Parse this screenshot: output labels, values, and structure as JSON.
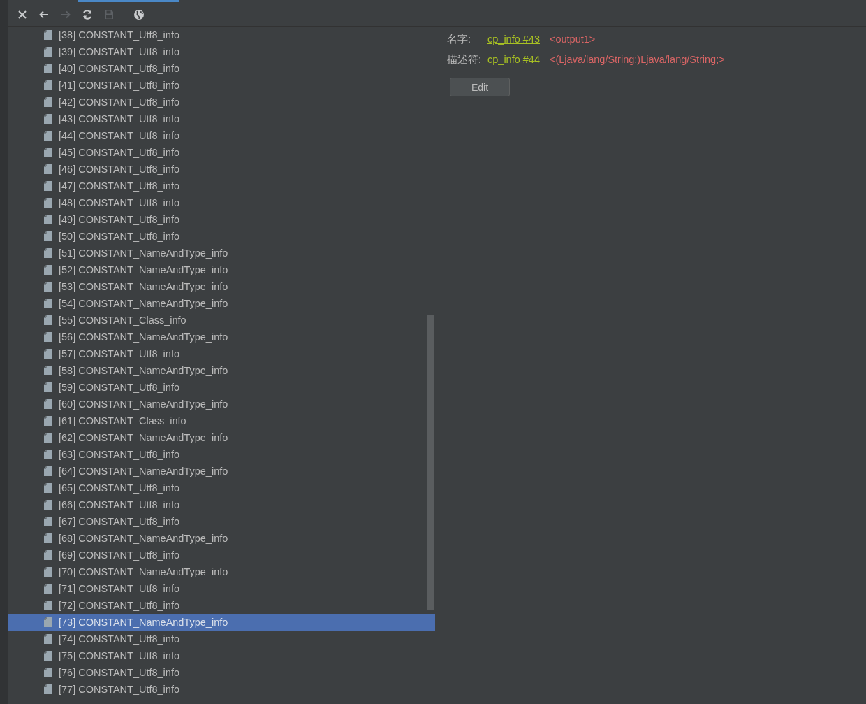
{
  "toolbar": [
    {
      "kind": "close",
      "disabled": false
    },
    {
      "kind": "back",
      "disabled": false
    },
    {
      "kind": "forward",
      "disabled": true
    },
    {
      "kind": "refresh",
      "disabled": false
    },
    {
      "kind": "save",
      "disabled": true
    },
    {
      "kind": "globe",
      "disabled": false
    }
  ],
  "tree": {
    "items": [
      {
        "label": "[38] CONSTANT_Utf8_info",
        "selected": false
      },
      {
        "label": "[39] CONSTANT_Utf8_info",
        "selected": false
      },
      {
        "label": "[40] CONSTANT_Utf8_info",
        "selected": false
      },
      {
        "label": "[41] CONSTANT_Utf8_info",
        "selected": false
      },
      {
        "label": "[42] CONSTANT_Utf8_info",
        "selected": false
      },
      {
        "label": "[43] CONSTANT_Utf8_info",
        "selected": false
      },
      {
        "label": "[44] CONSTANT_Utf8_info",
        "selected": false
      },
      {
        "label": "[45] CONSTANT_Utf8_info",
        "selected": false
      },
      {
        "label": "[46] CONSTANT_Utf8_info",
        "selected": false
      },
      {
        "label": "[47] CONSTANT_Utf8_info",
        "selected": false
      },
      {
        "label": "[48] CONSTANT_Utf8_info",
        "selected": false
      },
      {
        "label": "[49] CONSTANT_Utf8_info",
        "selected": false
      },
      {
        "label": "[50] CONSTANT_Utf8_info",
        "selected": false
      },
      {
        "label": "[51] CONSTANT_NameAndType_info",
        "selected": false
      },
      {
        "label": "[52] CONSTANT_NameAndType_info",
        "selected": false
      },
      {
        "label": "[53] CONSTANT_NameAndType_info",
        "selected": false
      },
      {
        "label": "[54] CONSTANT_NameAndType_info",
        "selected": false
      },
      {
        "label": "[55] CONSTANT_Class_info",
        "selected": false
      },
      {
        "label": "[56] CONSTANT_NameAndType_info",
        "selected": false
      },
      {
        "label": "[57] CONSTANT_Utf8_info",
        "selected": false
      },
      {
        "label": "[58] CONSTANT_NameAndType_info",
        "selected": false
      },
      {
        "label": "[59] CONSTANT_Utf8_info",
        "selected": false
      },
      {
        "label": "[60] CONSTANT_NameAndType_info",
        "selected": false
      },
      {
        "label": "[61] CONSTANT_Class_info",
        "selected": false
      },
      {
        "label": "[62] CONSTANT_NameAndType_info",
        "selected": false
      },
      {
        "label": "[63] CONSTANT_Utf8_info",
        "selected": false
      },
      {
        "label": "[64] CONSTANT_NameAndType_info",
        "selected": false
      },
      {
        "label": "[65] CONSTANT_Utf8_info",
        "selected": false
      },
      {
        "label": "[66] CONSTANT_Utf8_info",
        "selected": false
      },
      {
        "label": "[67] CONSTANT_Utf8_info",
        "selected": false
      },
      {
        "label": "[68] CONSTANT_NameAndType_info",
        "selected": false
      },
      {
        "label": "[69] CONSTANT_Utf8_info",
        "selected": false
      },
      {
        "label": "[70] CONSTANT_NameAndType_info",
        "selected": false
      },
      {
        "label": "[71] CONSTANT_Utf8_info",
        "selected": false
      },
      {
        "label": "[72] CONSTANT_Utf8_info",
        "selected": false
      },
      {
        "label": "[73] CONSTANT_NameAndType_info",
        "selected": true
      },
      {
        "label": "[74] CONSTANT_Utf8_info",
        "selected": false
      },
      {
        "label": "[75] CONSTANT_Utf8_info",
        "selected": false
      },
      {
        "label": "[76] CONSTANT_Utf8_info",
        "selected": false
      },
      {
        "label": "[77] CONSTANT_Utf8_info",
        "selected": false
      }
    ]
  },
  "details": {
    "fields": [
      {
        "label": "名字:",
        "link": "cp_info #43",
        "value": "<output1>"
      },
      {
        "label": "描述符:",
        "link": "cp_info #44",
        "value": "<(Ljava/lang/String;)Ljava/lang/String;>"
      }
    ],
    "button": "Edit"
  }
}
